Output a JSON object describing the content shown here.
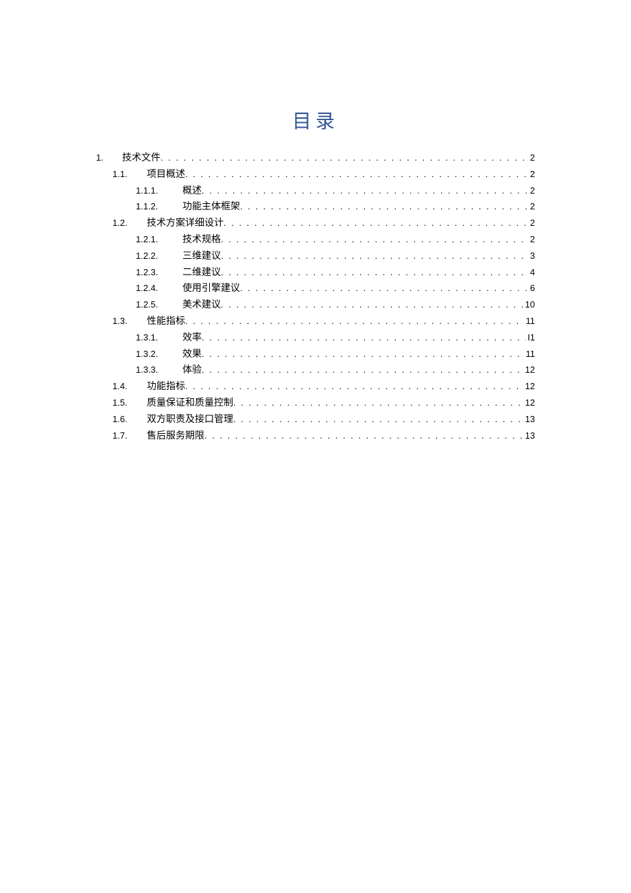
{
  "title": "目录",
  "toc": [
    {
      "level": 1,
      "num": "1.",
      "label": "技术文件",
      "page": "2"
    },
    {
      "level": 2,
      "num": "1.1.",
      "label": "项目概述",
      "page": "2"
    },
    {
      "level": 3,
      "num": "1.1.1.",
      "label": "概述",
      "page": "2"
    },
    {
      "level": 3,
      "num": "1.1.2.",
      "label": "功能主体框架",
      "page": "2"
    },
    {
      "level": 2,
      "num": "1.2.",
      "label": "技术方案详细设计",
      "page": "2"
    },
    {
      "level": 3,
      "num": "1.2.1.",
      "label": "技术规格",
      "page": "2"
    },
    {
      "level": 3,
      "num": "1.2.2.",
      "label": "三维建议",
      "page": "3"
    },
    {
      "level": 3,
      "num": "1.2.3.",
      "label": "二维建议",
      "page": "4"
    },
    {
      "level": 3,
      "num": "1.2.4.",
      "label": "使用引擎建议",
      "page": "6"
    },
    {
      "level": 3,
      "num": "1.2.5.",
      "label": "美术建议",
      "page": "10"
    },
    {
      "level": 2,
      "num": "1.3.",
      "label": "性能指标",
      "page": "11"
    },
    {
      "level": 3,
      "num": "1.3.1.",
      "label": "效率",
      "page": "I1"
    },
    {
      "level": 3,
      "num": "1.3.2.",
      "label": "效果",
      "page": "11"
    },
    {
      "level": 3,
      "num": "1.3.3.",
      "label": "体验",
      "page": "12"
    },
    {
      "level": 2,
      "num": "1.4.",
      "label": "功能指标",
      "page": "12"
    },
    {
      "level": 2,
      "num": "1.5.",
      "label": "质量保证和质量控制",
      "page": "12"
    },
    {
      "level": 2,
      "num": "1.6.",
      "label": "双方职责及接口管理",
      "page": "13"
    },
    {
      "level": 2,
      "num": "1.7.",
      "label": "售后服务期限",
      "page": "13"
    }
  ]
}
